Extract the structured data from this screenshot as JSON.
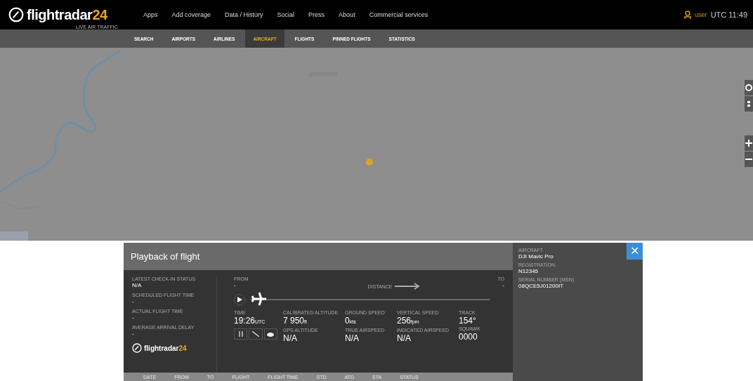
{
  "logo": {
    "name": "flightradar",
    "number": "24",
    "tagline": "LIVE AIR TRAFFIC"
  },
  "nav": [
    "Apps",
    "Add coverage",
    "Data / History",
    "Social",
    "Press",
    "About",
    "Commercial services"
  ],
  "user": {
    "label": "user",
    "clock": "UTC 11:49"
  },
  "tabs": [
    {
      "label": "SEARCH",
      "selected": false
    },
    {
      "label": "AIRPORTS",
      "selected": false
    },
    {
      "label": "AIRLINES",
      "selected": false
    },
    {
      "label": "AIRCRAFT",
      "selected": true
    },
    {
      "label": "FLIGHTS",
      "selected": false
    },
    {
      "label": "PINNED FLIGHTS",
      "selected": false
    },
    {
      "label": "STATISTICS",
      "selected": false
    }
  ],
  "playback": {
    "title": "Playback of flight",
    "left": [
      {
        "label": "LATEST CHECK-IN STATUS",
        "value": "N/A"
      },
      {
        "label": "SCHEDULED FLIGHT TIME",
        "value": "-"
      },
      {
        "label": "ACTUAL FLIGHT TIME",
        "value": "-"
      },
      {
        "label": "AVERAGE ARRIVAL DELAY",
        "value": "-"
      }
    ],
    "from": {
      "label": "FROM",
      "value": "-"
    },
    "to": {
      "label": "TO",
      "value": "-"
    },
    "distance": "DISTANCE",
    "progress": {
      "level": 0.0
    },
    "footer_logo": {
      "name": "flightradar",
      "number": "24"
    },
    "stats": [
      {
        "label": "TIME",
        "value": "19:26",
        "unit": "UTC"
      },
      {
        "label": "CALIBRATED ALTITUDE",
        "value": "7 950",
        "unit": "ft",
        "label2": "GPS ALTITUDE",
        "value2": "N/A"
      },
      {
        "label": "GROUND SPEED",
        "value": "0",
        "unit": "kts",
        "label2": "TRUE AIRSPEED",
        "value2": "N/A"
      },
      {
        "label": "VERTICAL SPEED",
        "value": "256",
        "unit": "fpm",
        "label2": "INDICATED AIRSPEED",
        "value2": "N/A"
      },
      {
        "label": "TRACK",
        "value": "154°",
        "label2": "SQUAWK",
        "value2": "0000"
      }
    ],
    "aircraft": [
      {
        "label": "AIRCRAFT",
        "value": "DJI Mavic Pro"
      },
      {
        "label": "REGISTRATION",
        "value": "N12345"
      },
      {
        "label": "SERIAL NUMBER (MSN)",
        "value": "08QCE5J01200IT"
      }
    ],
    "close": "✕",
    "columns": [
      "DATE",
      "FROM",
      "TO",
      "FLIGHT",
      "FLIGHT TIME",
      "STD",
      "ATD",
      "STA",
      "STATUS"
    ]
  }
}
